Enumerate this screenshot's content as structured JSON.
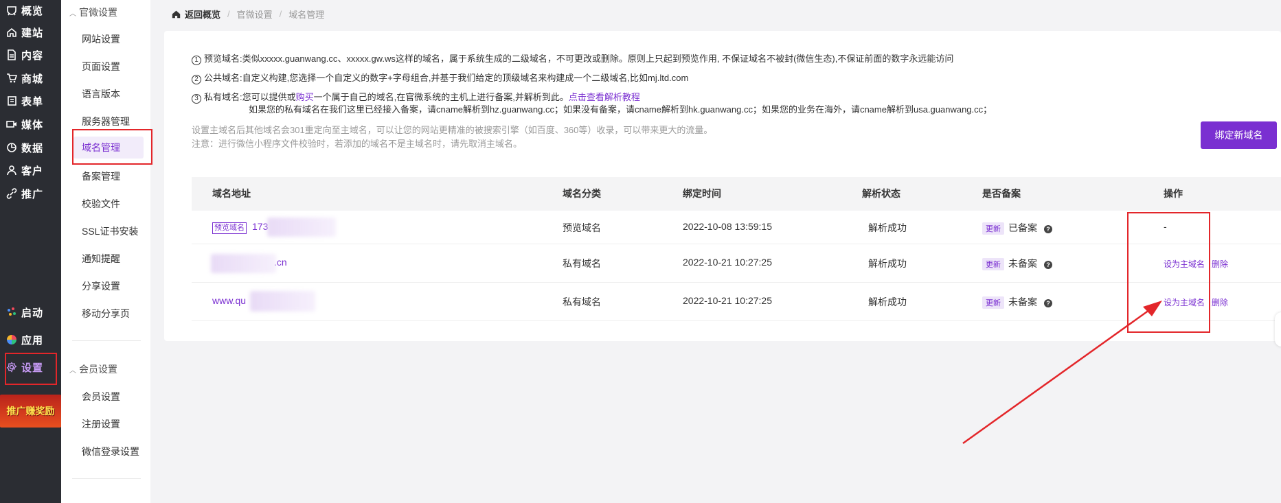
{
  "nav": {
    "items": [
      {
        "label": "概览",
        "icon": "dashboard-icon"
      },
      {
        "label": "建站",
        "icon": "home-icon"
      },
      {
        "label": "内容",
        "icon": "document-icon"
      },
      {
        "label": "商城",
        "icon": "cart-icon"
      },
      {
        "label": "表单",
        "icon": "form-icon"
      },
      {
        "label": "媒体",
        "icon": "video-icon"
      },
      {
        "label": "数据",
        "icon": "chart-icon"
      },
      {
        "label": "客户",
        "icon": "user-icon"
      },
      {
        "label": "推广",
        "icon": "link-icon"
      }
    ],
    "bottom": [
      {
        "label": "启动",
        "icon": "launch-icon"
      },
      {
        "label": "应用",
        "icon": "apps-icon"
      },
      {
        "label": "设置",
        "icon": "gear-icon"
      }
    ],
    "promo": "推广赚奖励"
  },
  "subnav": {
    "group1": "官微设置",
    "items1": [
      "网站设置",
      "页面设置",
      "语言版本",
      "服务器管理",
      "域名管理",
      "备案管理",
      "校验文件",
      "SSL证书安装",
      "通知提醒",
      "分享设置",
      "移动分享页"
    ],
    "group2": "会员设置",
    "items2": [
      "会员设置",
      "注册设置",
      "微信登录设置"
    ]
  },
  "breadcrumb": {
    "home": "返回概览",
    "level1": "官微设置",
    "level2": "域名管理"
  },
  "notes": {
    "n1_num": "1",
    "n1": "预览域名:类似xxxxx.guanwang.cc、xxxxx.gw.ws这样的域名，属于系统生成的二级域名，不可更改或删除。原则上只起到预览作用, 不保证域名不被封(微信生态),不保证前面的数字永远能访问",
    "n2_num": "2",
    "n2": "公共域名:自定义构建,您选择一个自定义的数字+字母组合,并基于我们给定的顶级域名来构建成一个二级域名,比如mj.ltd.com",
    "n3_num": "3",
    "n3_a": "私有域名:您可以提供或",
    "n3_link1": "购买",
    "n3_b": "一个属于自己的域名,在官微系统的主机上进行备案,并解析到此。",
    "n3_link2": "点击查看解析教程",
    "n3_sub": "如果您的私有域名在我们这里已经接入备案，请cname解析到hz.guanwang.cc；如果没有备案，请cname解析到hk.guanwang.cc；如果您的业务在海外，请cname解析到usa.guanwang.cc；",
    "gray1": "设置主域名后其他域名会301重定向至主域名，可以让您的网站更精准的被搜索引擎（如百度、360等）收录，可以带来更大的流量。",
    "gray2": "注意：进行微信小程序文件校验时，若添加的域名不是主域名时，请先取消主域名。"
  },
  "bind_button": "绑定新域名",
  "table": {
    "headers": [
      "域名地址",
      "域名分类",
      "绑定时间",
      "解析状态",
      "是否备案",
      "操作"
    ],
    "rows": [
      {
        "tag": "预览域名",
        "domain": "173",
        "category": "预览域名",
        "time": "2022-10-08 13:59:15",
        "status": "解析成功",
        "update": "更新",
        "record": "已备案",
        "ops": [
          "-"
        ]
      },
      {
        "tag": "",
        "domain": ".cn",
        "category": "私有域名",
        "time": "2022-10-21 10:27:25",
        "status": "解析成功",
        "update": "更新",
        "record": "未备案",
        "ops": [
          "设为主域名",
          "删除"
        ]
      },
      {
        "tag": "",
        "domain": "www.qu",
        "category": "私有域名",
        "time": "2022-10-21 10:27:25",
        "status": "解析成功",
        "update": "更新",
        "record": "未备案",
        "ops": [
          "设为主域名",
          "删除"
        ]
      }
    ]
  },
  "colors": {
    "accent": "#7a2fd1",
    "highlight": "#e3262a",
    "nav_bg": "#2b2d33"
  }
}
